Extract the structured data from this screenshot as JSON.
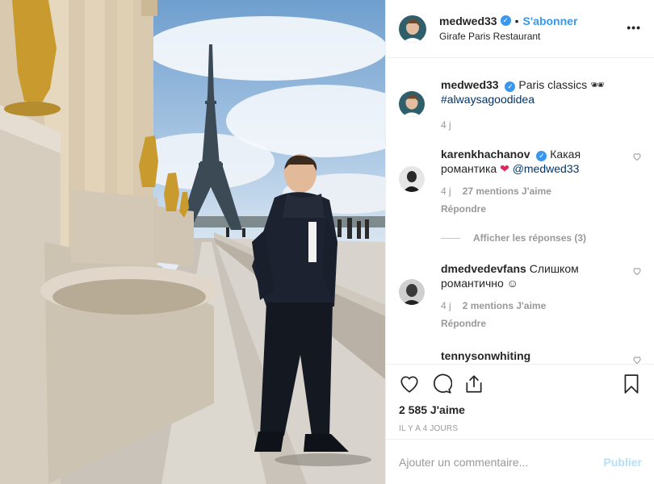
{
  "post": {
    "photo_alt": "Man standing at Trocadéro with Eiffel Tower in background"
  },
  "header": {
    "username": "medwed33",
    "verified_icon": "✓",
    "separator": "•",
    "follow_label": "S'abonner",
    "location": "Girafe Paris Restaurant",
    "more_icon": "•••"
  },
  "caption": {
    "username": "medwed33",
    "text": "Paris classics",
    "emoji": "🕶",
    "hashtag": "#alwaysagoodidea",
    "time": "4 j"
  },
  "comments": [
    {
      "username": "karenkhachanov",
      "text_before": "Какая романтика",
      "heart": "❤",
      "mention": "@medwed33",
      "time": "4 j",
      "likes": "27 mentions J'aime",
      "reply": "Répondre",
      "view_replies": "Afficher les réponses (3)"
    },
    {
      "username": "dmedvedevfans",
      "text": "Слишком романтично ☺",
      "time": "4 j",
      "likes": "2 mentions J'aime",
      "reply": "Répondre"
    },
    {
      "username": "tennysonwhiting"
    }
  ],
  "footer": {
    "likes_count": "2 585 J'aime",
    "posted_ago": "IL Y A 4 JOURS",
    "comment_placeholder": "Ajouter un commentaire...",
    "publish_label": "Publier"
  },
  "colors": {
    "accent": "#3897f0",
    "link": "#003569",
    "muted": "#999999",
    "publish_disabled": "#b2dffc"
  }
}
